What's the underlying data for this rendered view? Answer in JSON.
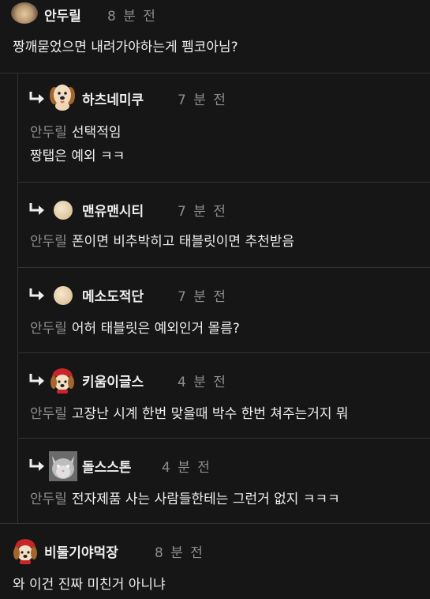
{
  "comments": [
    {
      "author": "안두릴",
      "time": "8 분 전",
      "text": "짱깨묻었으면 내려가야하는게 펨코아님?",
      "avatar_icon": "puppy-face-blurred"
    },
    {
      "author": "비둘기야먹장",
      "time": "8 분 전",
      "text": "와 이건 진짜 미친거 아니냐",
      "avatar_icon": "red-hood-dog"
    }
  ],
  "replies": [
    {
      "author": "하츠네미쿠",
      "time": "7 분 전",
      "mention": "안두릴",
      "text_lines": [
        "선택적임",
        "짱탭은 예외 ㅋㅋ"
      ],
      "avatar_icon": "puppy-face"
    },
    {
      "author": "맨유맨시티",
      "time": "7 분 전",
      "mention": "안두릴",
      "text_lines": [
        "폰이면 비추박히고 태블릿이면 추천받음"
      ],
      "avatar_icon": "beige-circle"
    },
    {
      "author": "메소도적단",
      "time": "7 분 전",
      "mention": "안두릴",
      "text_lines": [
        "어허 태블릿은 예외인거 몰름?"
      ],
      "avatar_icon": "beige-circle"
    },
    {
      "author": "키움이글스",
      "time": "4 분 전",
      "mention": "안두릴",
      "text_lines": [
        "고장난 시계 한번 맞을때 박수 한번 쳐주는거지 뭐"
      ],
      "avatar_icon": "red-hood-dog"
    },
    {
      "author": "돌스스톤",
      "time": "4 분 전",
      "mention": "안두릴",
      "text_lines": [
        "전자제품 사는 사람들한테는 그런거 없지 ㅋㅋㅋ"
      ],
      "avatar_icon": "cat-photo"
    }
  ],
  "colors": {
    "background": "#161616",
    "text": "#eeeeee",
    "muted": "#8e8e8e",
    "separator": "#333333"
  }
}
